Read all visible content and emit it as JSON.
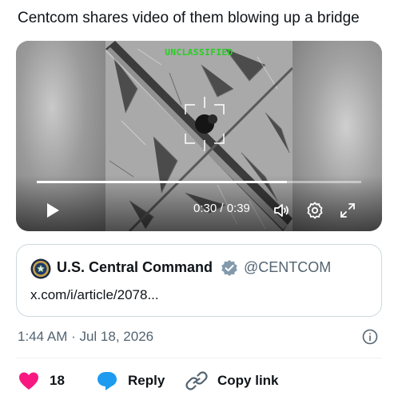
{
  "post": {
    "text": "Centcom shares video of them blowing up a bridge",
    "timestamp": "1:44 AM · Jul 18, 2026"
  },
  "video": {
    "overlay_label": "UNCLASSIFIED",
    "time_display": "0:30 / 0:39",
    "progress": 0.77,
    "icons": [
      "play-icon",
      "volume-icon",
      "settings-gear-icon",
      "fullscreen-expand-icon"
    ]
  },
  "quote": {
    "display_name": "U.S. Central Command",
    "handle": "@CENTCOM",
    "text": "x.com/i/article/2078..."
  },
  "actions": {
    "likes_count": "18",
    "reply_label": "Reply",
    "copy_link_label": "Copy link"
  },
  "colors": {
    "like": "#f91880",
    "reply": "#1d9bf0",
    "verified": "#829aab",
    "secondary_text": "#536471"
  }
}
